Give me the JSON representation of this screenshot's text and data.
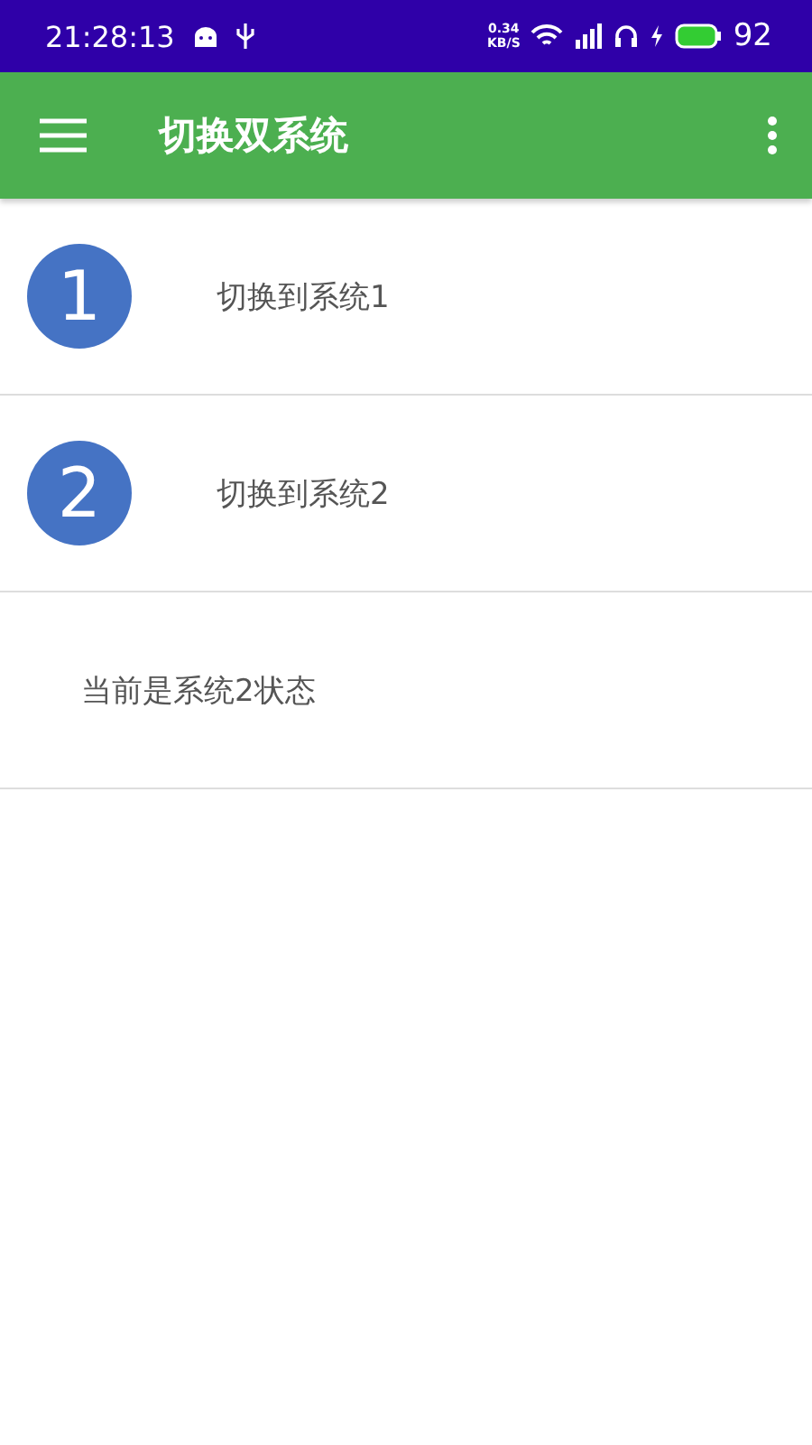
{
  "status_bar": {
    "time": "21:28:13",
    "speed_value": "0.34",
    "speed_unit": "KB/S",
    "battery": "92"
  },
  "app_bar": {
    "title": "切换双系统"
  },
  "options": [
    {
      "number": "1",
      "label": "切换到系统1"
    },
    {
      "number": "2",
      "label": "切换到系统2"
    }
  ],
  "status_text": "当前是系统2状态"
}
